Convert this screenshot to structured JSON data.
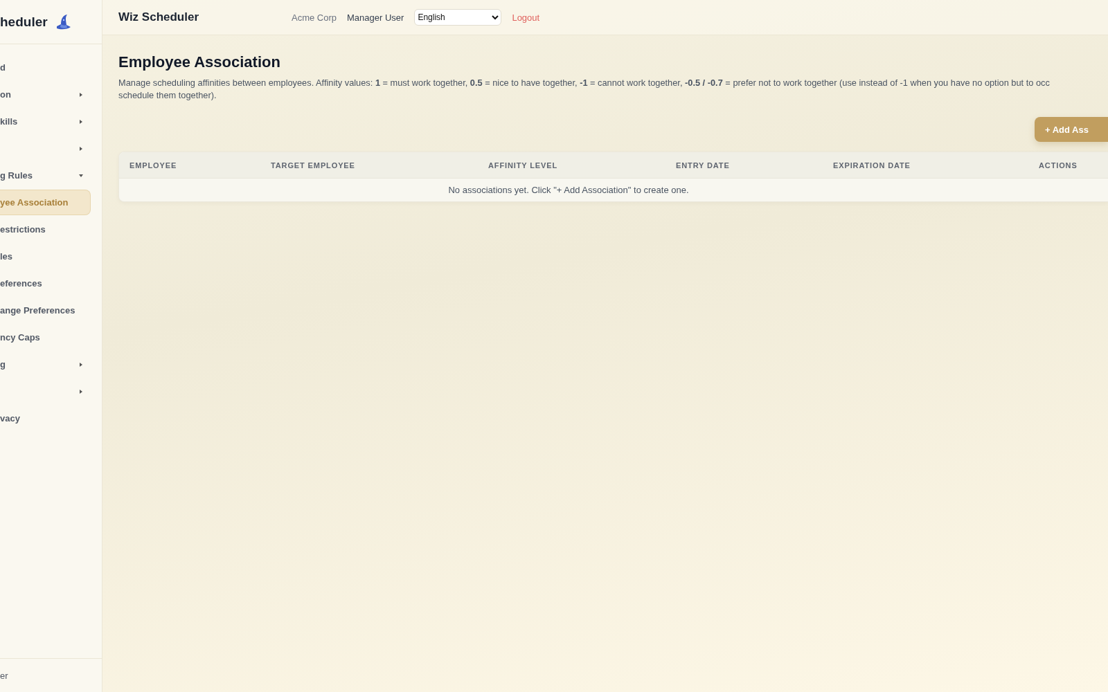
{
  "sidebar": {
    "brand": "heduler",
    "items": [
      {
        "label": "d",
        "selected": false
      },
      {
        "label": "on",
        "selected": false,
        "expanded": false
      },
      {
        "label": "kills",
        "selected": false,
        "expanded": false
      },
      {
        "selected": false,
        "expanded": false
      },
      {
        "label": "g Rules",
        "selected": false,
        "expanded": true,
        "children": [
          {
            "label": "yee Association",
            "selected": true
          },
          {
            "label": "estrictions",
            "selected": false
          },
          {
            "label": "les",
            "selected": false
          },
          {
            "label": "eferences",
            "selected": false
          },
          {
            "label": "ange Preferences",
            "selected": false
          },
          {
            "label": "ncy Caps",
            "selected": false
          }
        ]
      },
      {
        "label": "g",
        "selected": false,
        "expanded": false
      },
      {
        "selected": false,
        "expanded": false
      },
      {
        "label": "vacy",
        "selected": false
      }
    ],
    "footer": "er"
  },
  "topbar": {
    "title": "Wiz Scheduler",
    "company": "Acme Corp",
    "user": "Manager User",
    "language": "English",
    "logout": "Logout"
  },
  "page": {
    "title": "Employee Association",
    "description_lines": [
      "Manage scheduling affinities between employees. Affinity values: **1** = must work together, **0.5** = nice to have together, **-1** = cannot work together, **-0.5 / -0.7** = prefer not to work together (use instead of -1 when you have no option but to occ",
      "schedule them together)."
    ],
    "add_button": "+ Add Ass"
  },
  "table": {
    "columns": [
      "EMPLOYEE",
      "TARGET EMPLOYEE",
      "AFFINITY LEVEL",
      "ENTRY DATE",
      "EXPIRATION DATE",
      "ACTIONS"
    ],
    "empty_message": "No associations yet. Click \"+ Add Association\" to create one."
  }
}
